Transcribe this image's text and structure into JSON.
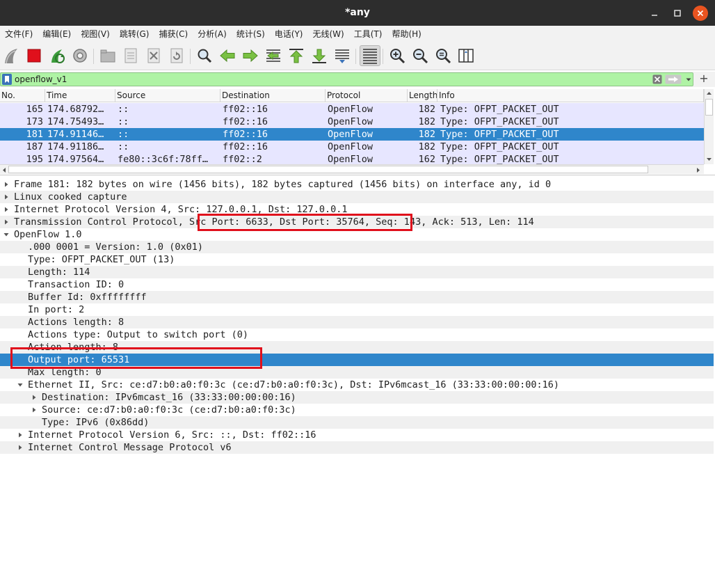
{
  "window": {
    "title": "*any",
    "minimize_glyph": "–",
    "maximize_glyph": "□",
    "close_glyph": "✕"
  },
  "menu": [
    "文件(F)",
    "编辑(E)",
    "视图(V)",
    "跳转(G)",
    "捕获(C)",
    "分析(A)",
    "统计(S)",
    "电话(Y)",
    "无线(W)",
    "工具(T)",
    "帮助(H)"
  ],
  "toolbar": {
    "icons": [
      "start-capture-icon",
      "stop-capture-icon",
      "restart-capture-icon",
      "capture-options-icon",
      "open-file-icon",
      "save-file-icon",
      "close-file-icon",
      "reload-file-icon",
      "find-packet-icon",
      "go-back-icon",
      "go-forward-icon",
      "go-to-packet-icon",
      "go-first-icon",
      "go-last-icon",
      "auto-scroll-icon",
      "colorize-icon",
      "zoom-in-icon",
      "zoom-out-icon",
      "zoom-normal-icon",
      "resize-columns-icon"
    ]
  },
  "filter": {
    "value": "openflow_v1",
    "add_glyph": "+"
  },
  "packet_list": {
    "columns": [
      "No.",
      "Time",
      "Source",
      "Destination",
      "Protocol",
      "Length",
      "Info"
    ],
    "rows": [
      {
        "no": "165",
        "time": "174.68792…",
        "source": "::",
        "destination": "ff02::16",
        "protocol": "OpenFlow",
        "length": "182",
        "info": "Type: OFPT_PACKET_OUT",
        "selected": false
      },
      {
        "no": "173",
        "time": "174.75493…",
        "source": "::",
        "destination": "ff02::16",
        "protocol": "OpenFlow",
        "length": "182",
        "info": "Type: OFPT_PACKET_OUT",
        "selected": false
      },
      {
        "no": "181",
        "time": "174.91146…",
        "source": "::",
        "destination": "ff02::16",
        "protocol": "OpenFlow",
        "length": "182",
        "info": "Type: OFPT_PACKET_OUT",
        "selected": true
      },
      {
        "no": "187",
        "time": "174.91186…",
        "source": "::",
        "destination": "ff02::16",
        "protocol": "OpenFlow",
        "length": "182",
        "info": "Type: OFPT_PACKET_OUT",
        "selected": false
      },
      {
        "no": "195",
        "time": "174.97564…",
        "source": "fe80::3c6f:78ff…",
        "destination": "ff02::2",
        "protocol": "OpenFlow",
        "length": "162",
        "info": "Type: OFPT_PACKET_OUT",
        "selected": false
      }
    ]
  },
  "details": [
    {
      "text": "Frame 181: 182 bytes on wire (1456 bits), 182 bytes captured (1456 bits) on interface any, id 0",
      "level": 0,
      "arrow": "right",
      "selected": false
    },
    {
      "text": "Linux cooked capture",
      "level": 0,
      "arrow": "right",
      "selected": false
    },
    {
      "text": "Internet Protocol Version 4, Src: 127.0.0.1, Dst: 127.0.0.1",
      "level": 0,
      "arrow": "right",
      "selected": false
    },
    {
      "text": "Transmission Control Protocol, Src Port: 6633, Dst Port: 35764, Seq: 143, Ack: 513, Len: 114",
      "level": 0,
      "arrow": "right",
      "selected": false
    },
    {
      "text": "OpenFlow 1.0",
      "level": 0,
      "arrow": "down",
      "selected": false
    },
    {
      "text": ".000 0001 = Version: 1.0 (0x01)",
      "level": 1,
      "arrow": "none",
      "selected": false
    },
    {
      "text": "Type: OFPT_PACKET_OUT (13)",
      "level": 1,
      "arrow": "none",
      "selected": false
    },
    {
      "text": "Length: 114",
      "level": 1,
      "arrow": "none",
      "selected": false
    },
    {
      "text": "Transaction ID: 0",
      "level": 1,
      "arrow": "none",
      "selected": false
    },
    {
      "text": "Buffer Id: 0xffffffff",
      "level": 1,
      "arrow": "none",
      "selected": false
    },
    {
      "text": "In port: 2",
      "level": 1,
      "arrow": "none",
      "selected": false
    },
    {
      "text": "Actions length: 8",
      "level": 1,
      "arrow": "none",
      "selected": false
    },
    {
      "text": "Actions type: Output to switch port (0)",
      "level": 1,
      "arrow": "none",
      "selected": false
    },
    {
      "text": "Action length: 8",
      "level": 1,
      "arrow": "none",
      "selected": false
    },
    {
      "text": "Output port: 65531",
      "level": 1,
      "arrow": "none",
      "selected": true
    },
    {
      "text": "Max length: 0",
      "level": 1,
      "arrow": "none",
      "selected": false
    },
    {
      "text": "Ethernet II, Src: ce:d7:b0:a0:f0:3c (ce:d7:b0:a0:f0:3c), Dst: IPv6mcast_16 (33:33:00:00:00:16)",
      "level": 1,
      "arrow": "down",
      "selected": false
    },
    {
      "text": "Destination: IPv6mcast_16 (33:33:00:00:00:16)",
      "level": 2,
      "arrow": "right",
      "selected": false
    },
    {
      "text": "Source: ce:d7:b0:a0:f0:3c (ce:d7:b0:a0:f0:3c)",
      "level": 2,
      "arrow": "right",
      "selected": false
    },
    {
      "text": "Type: IPv6 (0x86dd)",
      "level": 2,
      "arrow": "none",
      "selected": false
    },
    {
      "text": "Internet Protocol Version 6, Src: ::, Dst: ff02::16",
      "level": 1,
      "arrow": "right",
      "selected": false
    },
    {
      "text": "Internet Control Message Protocol v6",
      "level": 1,
      "arrow": "right",
      "selected": false
    }
  ],
  "colors": {
    "selection": "#2f86cb",
    "openflow_row": "#e7e6ff",
    "filter_valid": "#aff3a5",
    "annotation": "#e0101c"
  }
}
